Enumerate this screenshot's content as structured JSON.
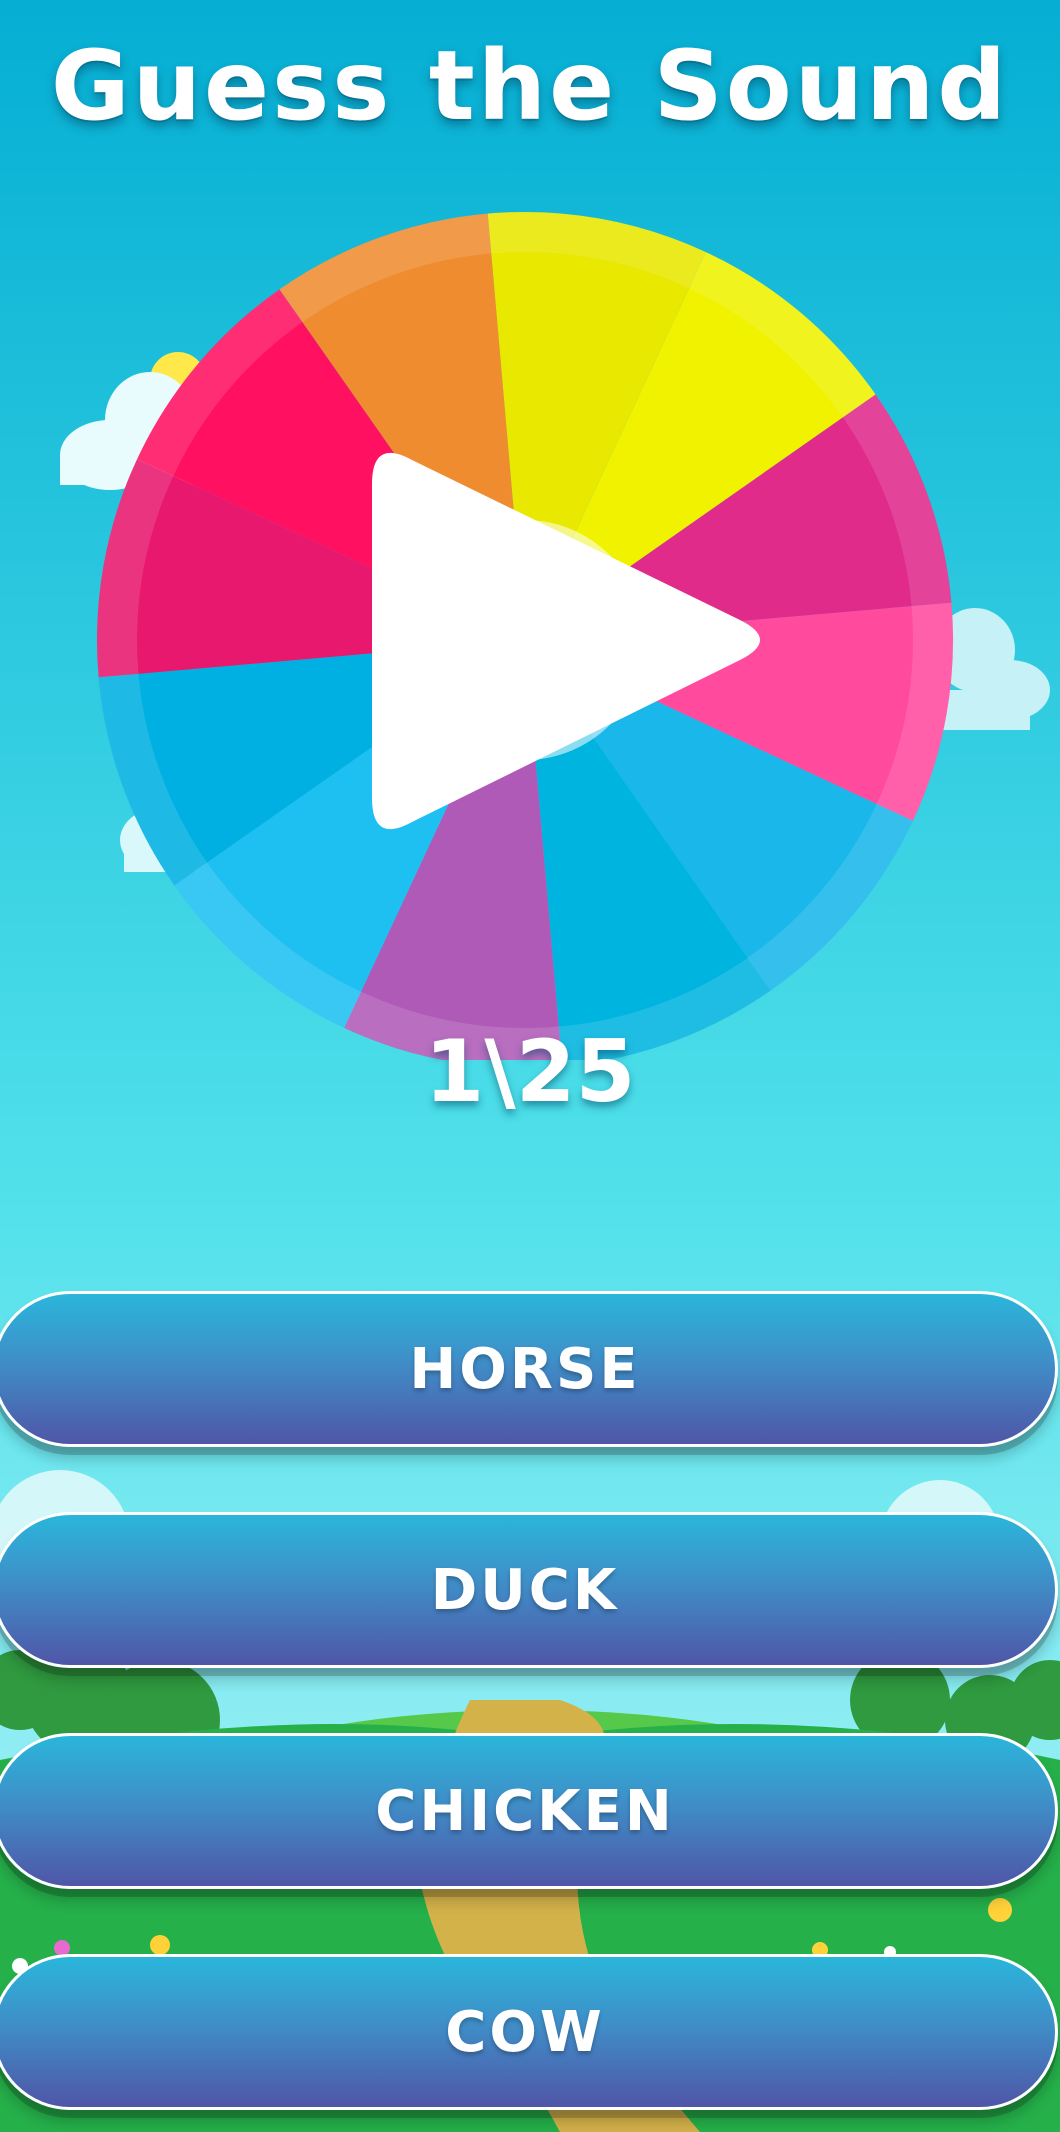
{
  "title": "Guess the Sound",
  "icons": {
    "play": "play-icon"
  },
  "progress": {
    "current": 1,
    "total": 25,
    "label": "1\\25"
  },
  "answers": [
    {
      "label": "HORSE"
    },
    {
      "label": "DUCK"
    },
    {
      "label": "CHICKEN"
    },
    {
      "label": "COW"
    }
  ],
  "colors": {
    "sky_top": "#05aed3",
    "sky_bottom": "#8ff2f6",
    "button_top": "#2ab6db",
    "button_bottom": "#4f56a7",
    "wheel_segments": [
      "#e8e800",
      "#f0f200",
      "#e02b8b",
      "#ff4a9e",
      "#1ab7eb",
      "#00b4e0",
      "#b05ab8",
      "#1ec0f2",
      "#00b0e2",
      "#e8186e",
      "#ff1060",
      "#f08c30"
    ]
  }
}
